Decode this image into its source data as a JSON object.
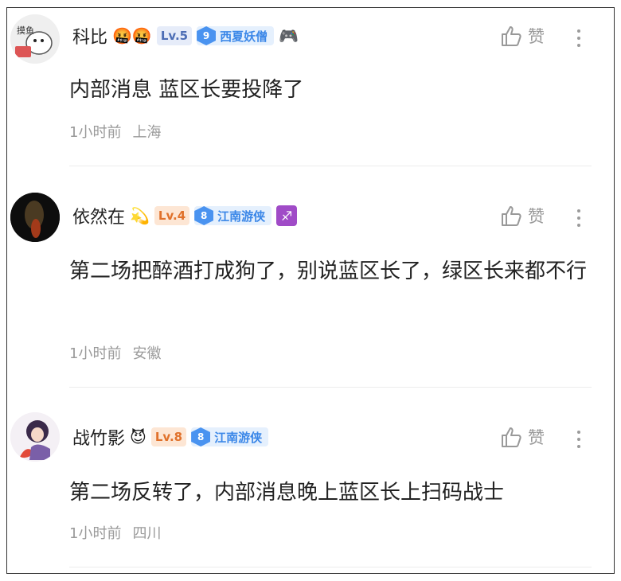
{
  "comments": [
    {
      "username": "科比",
      "emojis": "🤬🤬",
      "level": "Lv.5",
      "badge_number": "9",
      "badge_text": "西夏妖僧",
      "extra_icon": "🎮",
      "text": "内部消息 蓝区长要投降了",
      "time": "1小时前",
      "location": "上海",
      "like_label": "赞",
      "avatar_icon": "panda-cartoon-avatar"
    },
    {
      "username": "依然在",
      "emojis": "💫",
      "level": "Lv.4",
      "badge_number": "8",
      "badge_text": "江南游侠",
      "extra_icon": "♐",
      "text": "第二场把醉酒打成狗了，别说蓝区长了，绿区长来都不行",
      "time": "1小时前",
      "location": "安徽",
      "like_label": "赞",
      "avatar_icon": "dark-figure-avatar"
    },
    {
      "username": "战竹影",
      "emojis": "😈",
      "level": "Lv.8",
      "badge_number": "8",
      "badge_text": "江南游侠",
      "extra_icon": "",
      "text": "第二场反转了，内部消息晚上蓝区长上扫码战士",
      "time": "1小时前",
      "location": "四川",
      "like_label": "赞",
      "avatar_icon": "anime-character-avatar"
    }
  ]
}
